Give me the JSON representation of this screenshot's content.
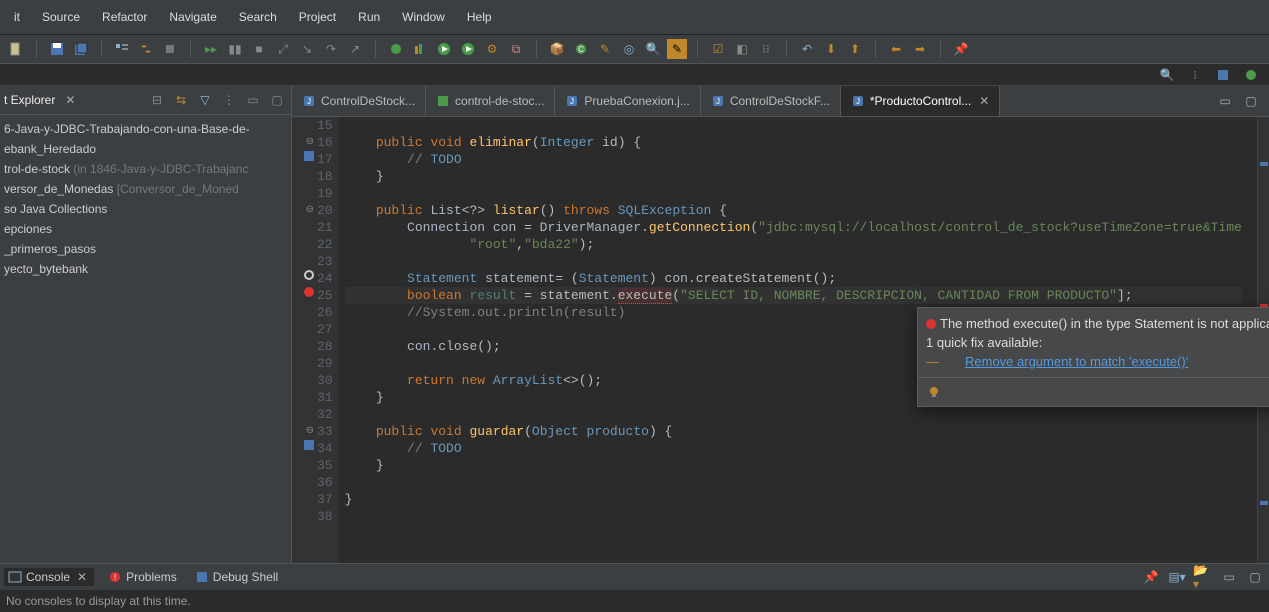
{
  "menu": [
    "it",
    "Source",
    "Refactor",
    "Navigate",
    "Search",
    "Project",
    "Run",
    "Window",
    "Help"
  ],
  "explorer_title": "t Explorer",
  "tree": [
    {
      "label": "6-Java-y-JDBC-Trabajando-con-una-Base-de-",
      "dim": ""
    },
    {
      "label": "ebank_Heredado",
      "dim": ""
    },
    {
      "label": "trol-de-stock",
      "dim": " (in 1846-Java-y-JDBC-Trabajanc"
    },
    {
      "label": "versor_de_Monedas",
      "dim": " [Conversor_de_Moned"
    },
    {
      "label": "so Java Collections",
      "dim": ""
    },
    {
      "label": "epciones",
      "dim": ""
    },
    {
      "label": "_primeros_pasos",
      "dim": ""
    },
    {
      "label": "yecto_bytebank",
      "dim": ""
    }
  ],
  "tabs": [
    {
      "label": "ControlDeStock...",
      "icon": "java"
    },
    {
      "label": "control-de-stoc...",
      "icon": "xml"
    },
    {
      "label": "PruebaConexion.j...",
      "icon": "java"
    },
    {
      "label": "ControlDeStockF...",
      "icon": "java"
    },
    {
      "label": "*ProductoControl...",
      "icon": "java",
      "active": true,
      "closable": true
    }
  ],
  "lines": {
    "start": 15,
    "end": 38,
    "markers": {
      "16": "folding",
      "17": "task",
      "20": "folding",
      "24": "warn-ring",
      "25": "error",
      "33": "folding",
      "34": "task"
    }
  },
  "code": {
    "15": [
      {
        "t": "",
        "c": ""
      }
    ],
    "16": [
      {
        "t": "    ",
        "c": ""
      },
      {
        "t": "public",
        "c": "k-key"
      },
      {
        "t": " ",
        "c": ""
      },
      {
        "t": "void",
        "c": "k-key"
      },
      {
        "t": " ",
        "c": ""
      },
      {
        "t": "eliminar",
        "c": "k-method"
      },
      {
        "t": "(",
        "c": ""
      },
      {
        "t": "Integer",
        "c": "k-id"
      },
      {
        "t": " id) {",
        "c": ""
      }
    ],
    "17": [
      {
        "t": "        ",
        "c": ""
      },
      {
        "t": "// ",
        "c": "k-comment"
      },
      {
        "t": "TODO",
        "c": "k-id"
      }
    ],
    "18": [
      {
        "t": "    }",
        "c": ""
      }
    ],
    "19": [
      {
        "t": "",
        "c": ""
      }
    ],
    "20": [
      {
        "t": "    ",
        "c": ""
      },
      {
        "t": "public",
        "c": "k-key"
      },
      {
        "t": " ",
        "c": ""
      },
      {
        "t": "List",
        "c": "k-type"
      },
      {
        "t": "<?> ",
        "c": ""
      },
      {
        "t": "listar",
        "c": "k-method"
      },
      {
        "t": "() ",
        "c": ""
      },
      {
        "t": "throws",
        "c": "k-key"
      },
      {
        "t": " ",
        "c": ""
      },
      {
        "t": "SQLException",
        "c": "k-id"
      },
      {
        "t": " {",
        "c": ""
      }
    ],
    "21": [
      {
        "t": "        ",
        "c": ""
      },
      {
        "t": "Connection ",
        "c": "k-type"
      },
      {
        "t": "con",
        "c": "k-type"
      },
      {
        "t": " = ",
        "c": ""
      },
      {
        "t": "DriverManager",
        "c": "k-type"
      },
      {
        "t": ".",
        "c": ""
      },
      {
        "t": "getConnection",
        "c": "k-method"
      },
      {
        "t": "(",
        "c": ""
      },
      {
        "t": "\"jdbc:mysql://localhost/control_de_stock?useTimeZone=true&Time",
        "c": "k-string"
      }
    ],
    "22": [
      {
        "t": "                ",
        "c": ""
      },
      {
        "t": "\"root\"",
        "c": "k-string"
      },
      {
        "t": ",",
        "c": ""
      },
      {
        "t": "\"bda22\"",
        "c": "k-string"
      },
      {
        "t": ");",
        "c": ""
      }
    ],
    "23": [
      {
        "t": "",
        "c": ""
      }
    ],
    "24": [
      {
        "t": "        ",
        "c": ""
      },
      {
        "t": "Statement",
        "c": "k-id"
      },
      {
        "t": " ",
        "c": ""
      },
      {
        "t": "statement",
        "c": "k-type"
      },
      {
        "t": "= (",
        "c": ""
      },
      {
        "t": "Statement",
        "c": "k-id"
      },
      {
        "t": ") ",
        "c": ""
      },
      {
        "t": "con",
        "c": "k-type"
      },
      {
        "t": ".createStatement();",
        "c": ""
      }
    ],
    "25": [
      {
        "t": "        ",
        "c": ""
      },
      {
        "t": "boolean",
        "c": "k-key"
      },
      {
        "t": " ",
        "c": ""
      },
      {
        "t": "result",
        "c": "k-class"
      },
      {
        "t": " = statement.",
        "c": ""
      },
      {
        "t": "execute",
        "c": "k-err"
      },
      {
        "t": "(",
        "c": ""
      },
      {
        "t": "\"SELECT ID, NOMBRE, DESCRIPCION, CANTIDAD FROM PRODUCTO\"",
        "c": "k-string"
      },
      {
        "t": "]",
        "c": ""
      },
      {
        "t": ";",
        "c": ""
      }
    ],
    "26": [
      {
        "t": "        ",
        "c": ""
      },
      {
        "t": "//System.out.println(result)",
        "c": "k-comment"
      }
    ],
    "27": [
      {
        "t": "",
        "c": ""
      }
    ],
    "28": [
      {
        "t": "        ",
        "c": ""
      },
      {
        "t": "con",
        "c": "k-type"
      },
      {
        "t": ".close();",
        "c": ""
      }
    ],
    "29": [
      {
        "t": "",
        "c": ""
      }
    ],
    "30": [
      {
        "t": "        ",
        "c": ""
      },
      {
        "t": "return",
        "c": "k-key"
      },
      {
        "t": " ",
        "c": ""
      },
      {
        "t": "new",
        "c": "k-key"
      },
      {
        "t": " ",
        "c": ""
      },
      {
        "t": "ArrayList",
        "c": "k-id"
      },
      {
        "t": "<>();",
        "c": ""
      }
    ],
    "31": [
      {
        "t": "    }",
        "c": ""
      }
    ],
    "32": [
      {
        "t": "",
        "c": ""
      }
    ],
    "33": [
      {
        "t": "    ",
        "c": ""
      },
      {
        "t": "public",
        "c": "k-key"
      },
      {
        "t": " ",
        "c": ""
      },
      {
        "t": "void",
        "c": "k-key"
      },
      {
        "t": " ",
        "c": ""
      },
      {
        "t": "guardar",
        "c": "k-method"
      },
      {
        "t": "(",
        "c": ""
      },
      {
        "t": "Object",
        "c": "k-id"
      },
      {
        "t": " ",
        "c": ""
      },
      {
        "t": "producto",
        "c": "k-id"
      },
      {
        "t": ") {",
        "c": ""
      }
    ],
    "34": [
      {
        "t": "        ",
        "c": ""
      },
      {
        "t": "// ",
        "c": "k-comment"
      },
      {
        "t": "TODO",
        "c": "k-id"
      }
    ],
    "35": [
      {
        "t": "    }",
        "c": ""
      }
    ],
    "36": [
      {
        "t": "",
        "c": ""
      }
    ],
    "37": [
      {
        "t": "}",
        "c": ""
      }
    ],
    "38": [
      {
        "t": "",
        "c": ""
      }
    ]
  },
  "hover": {
    "message": "The method execute() in the type Statement is not applicable for the arguments (String)",
    "quickfix_count": "1 quick fix available:",
    "quickfix_link": "Remove argument to match 'execute()'"
  },
  "bottom_tabs": {
    "console": "Console",
    "problems": "Problems",
    "debug": "Debug Shell"
  },
  "console_text": "No consoles to display at this time."
}
